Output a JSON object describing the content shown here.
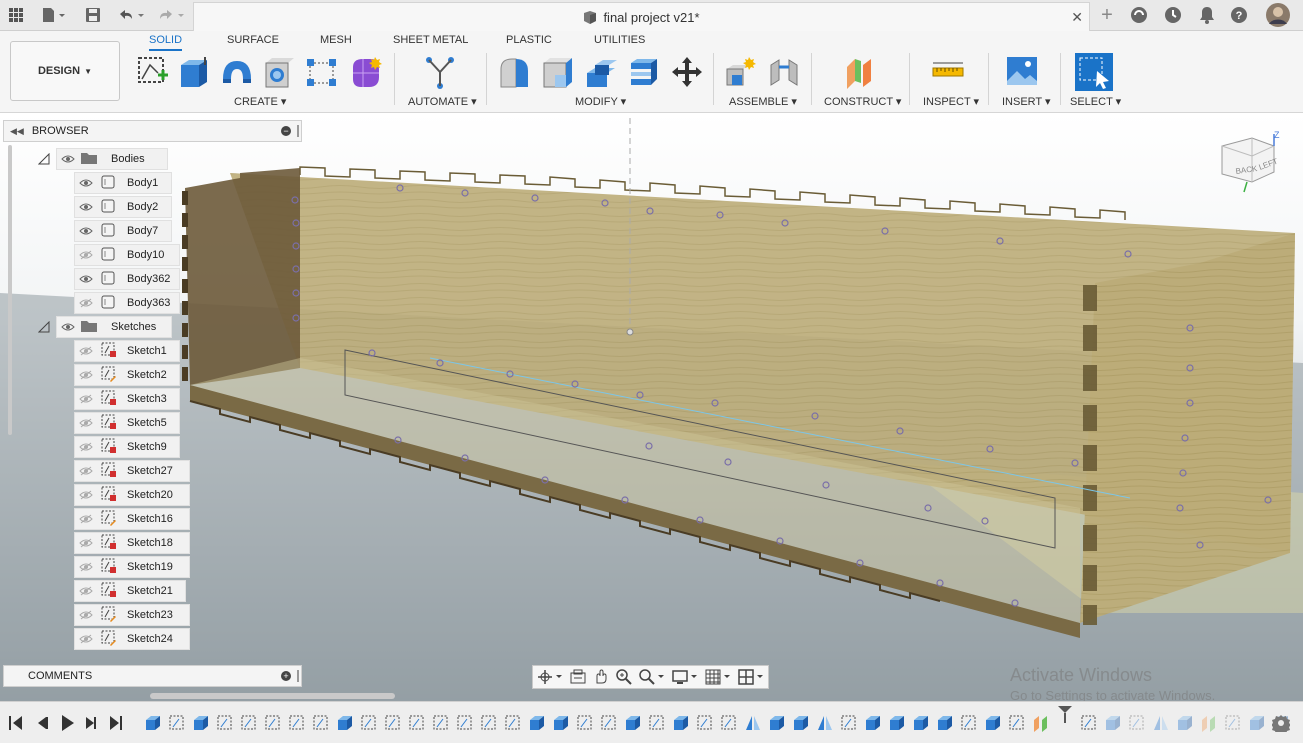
{
  "titlebar": {
    "document_title": "final project v21*"
  },
  "workspace": {
    "button_label": "DESIGN",
    "tabs": [
      "SOLID",
      "SURFACE",
      "MESH",
      "SHEET METAL",
      "PLASTIC",
      "UTILITIES"
    ],
    "active_tab": "SOLID"
  },
  "toolbar": {
    "groups": {
      "create": "CREATE",
      "automate": "AUTOMATE",
      "modify": "MODIFY",
      "assemble": "ASSEMBLE",
      "construct": "CONSTRUCT",
      "inspect": "INSPECT",
      "insert": "INSERT",
      "select": "SELECT"
    }
  },
  "browser": {
    "title": "BROWSER",
    "bodies_label": "Bodies",
    "bodies": [
      "Body1",
      "Body2",
      "Body7",
      "Body10",
      "Body362",
      "Body363"
    ],
    "sketches_label": "Sketches",
    "sketches": [
      "Sketch1",
      "Sketch2",
      "Sketch3",
      "Sketch5",
      "Sketch9",
      "Sketch27",
      "Sketch20",
      "Sketch16",
      "Sketch18",
      "Sketch19",
      "Sketch21",
      "Sketch23",
      "Sketch24"
    ]
  },
  "comments": {
    "title": "COMMENTS"
  },
  "viewcube": {
    "back": "BACK",
    "left": "LEFT",
    "axis": "Z"
  },
  "watermark": {
    "line1": "Activate Windows",
    "line2": "Go to Settings to activate Windows."
  },
  "colors": {
    "accent": "#1a73c8",
    "wood": "#b9a877",
    "sketch_point": "#7a6fa8"
  }
}
